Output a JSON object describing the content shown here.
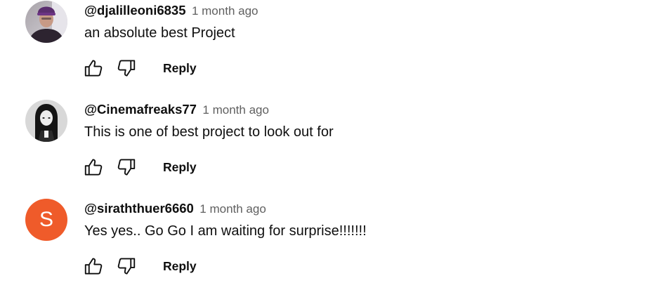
{
  "comments": [
    {
      "author": "@djalilleoni6835",
      "time": "1 month ago",
      "text": "an absolute best Project",
      "reply_label": "Reply",
      "avatar": {
        "type": "photo",
        "icon": "profile-photo"
      }
    },
    {
      "author": "@Cinemafreaks77",
      "time": "1 month ago",
      "text": "This is one of best project to look out for",
      "reply_label": "Reply",
      "avatar": {
        "type": "photo",
        "icon": "profile-photo-bw"
      }
    },
    {
      "author": "@siraththuer6660",
      "time": "1 month ago",
      "text": "Yes yes.. Go Go I am waiting for surprise!!!!!!!",
      "reply_label": "Reply",
      "avatar": {
        "type": "letter",
        "letter": "S",
        "color": "#ef5b2a"
      }
    }
  ],
  "icons": {
    "like": "thumbs-up-icon",
    "dislike": "thumbs-down-icon"
  }
}
